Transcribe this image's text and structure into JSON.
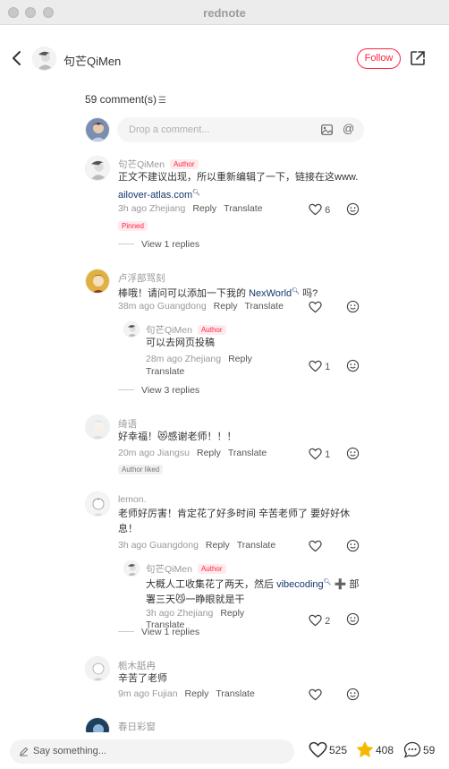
{
  "window": {
    "title": "rednote"
  },
  "header": {
    "author": "句芒QiMen",
    "follow_label": "Follow"
  },
  "comments_header": {
    "count": "59 comment(s)",
    "sort_icon": "sort-icon"
  },
  "comment_input": {
    "placeholder": "Drop a comment..."
  },
  "comments": [
    {
      "name": "句芒QiMen",
      "badge": "Author",
      "text1": "正文不建议出现，所以重新编辑了一下，链接在这www.",
      "link": "ailover-atlas.com",
      "meta": "3h ago Zhejiang",
      "reply": "Reply",
      "translate": "Translate",
      "likes": "6",
      "pinned": "Pinned",
      "view_replies": "View 1 replies"
    },
    {
      "name": "卢浮部骂刻",
      "text1": "棒哦！请问可以添加一下我的 ",
      "link": "NexWorld",
      "text2": " 吗?",
      "meta": "38m ago Guangdong",
      "reply": "Reply",
      "translate": "Translate",
      "likes": "",
      "sub_reply": {
        "name": "句芒QiMen",
        "badge": "Author",
        "text": "可以去网页投稿",
        "meta": "28m ago Zhejiang",
        "reply": "Reply",
        "translate": "Translate",
        "likes": "1"
      },
      "view_replies": "View 3 replies"
    },
    {
      "name": "绮语",
      "text": "好幸福！😻感谢老师！！！",
      "meta": "20m ago Jiangsu",
      "reply": "Reply",
      "translate": "Translate",
      "likes": "1",
      "author_liked": "Author liked"
    },
    {
      "name": "lemon.",
      "text1": "老师好厉害！肯定花了好多时间 辛苦老师了 要好好休",
      "text2": "息！",
      "meta": "3h ago Guangdong",
      "reply": "Reply",
      "translate": "Translate",
      "likes": "",
      "sub_reply": {
        "name": "句芒QiMen",
        "badge": "Author",
        "text1": "大概人工收集花了两天，然后 ",
        "link": "vibecoding",
        "text2": " ➕ 部",
        "text3": "署三天😼一睁眼就是干",
        "meta": "3h ago Zhejiang",
        "reply": "Reply",
        "translate": "Translate",
        "likes": "2"
      },
      "view_replies": "View 1 replies"
    },
    {
      "name": "栀木舐冉",
      "text": "辛苦了老师",
      "meta": "9m ago Fujian",
      "reply": "Reply",
      "translate": "Translate",
      "likes": ""
    },
    {
      "name": "春日彩窗"
    }
  ],
  "bottom_bar": {
    "placeholder": "Say something...",
    "likes": "525",
    "stars": "408",
    "comments": "59"
  },
  "colors": {
    "accent": "#ff2442",
    "link": "#13386c",
    "star": "#f5b800"
  }
}
